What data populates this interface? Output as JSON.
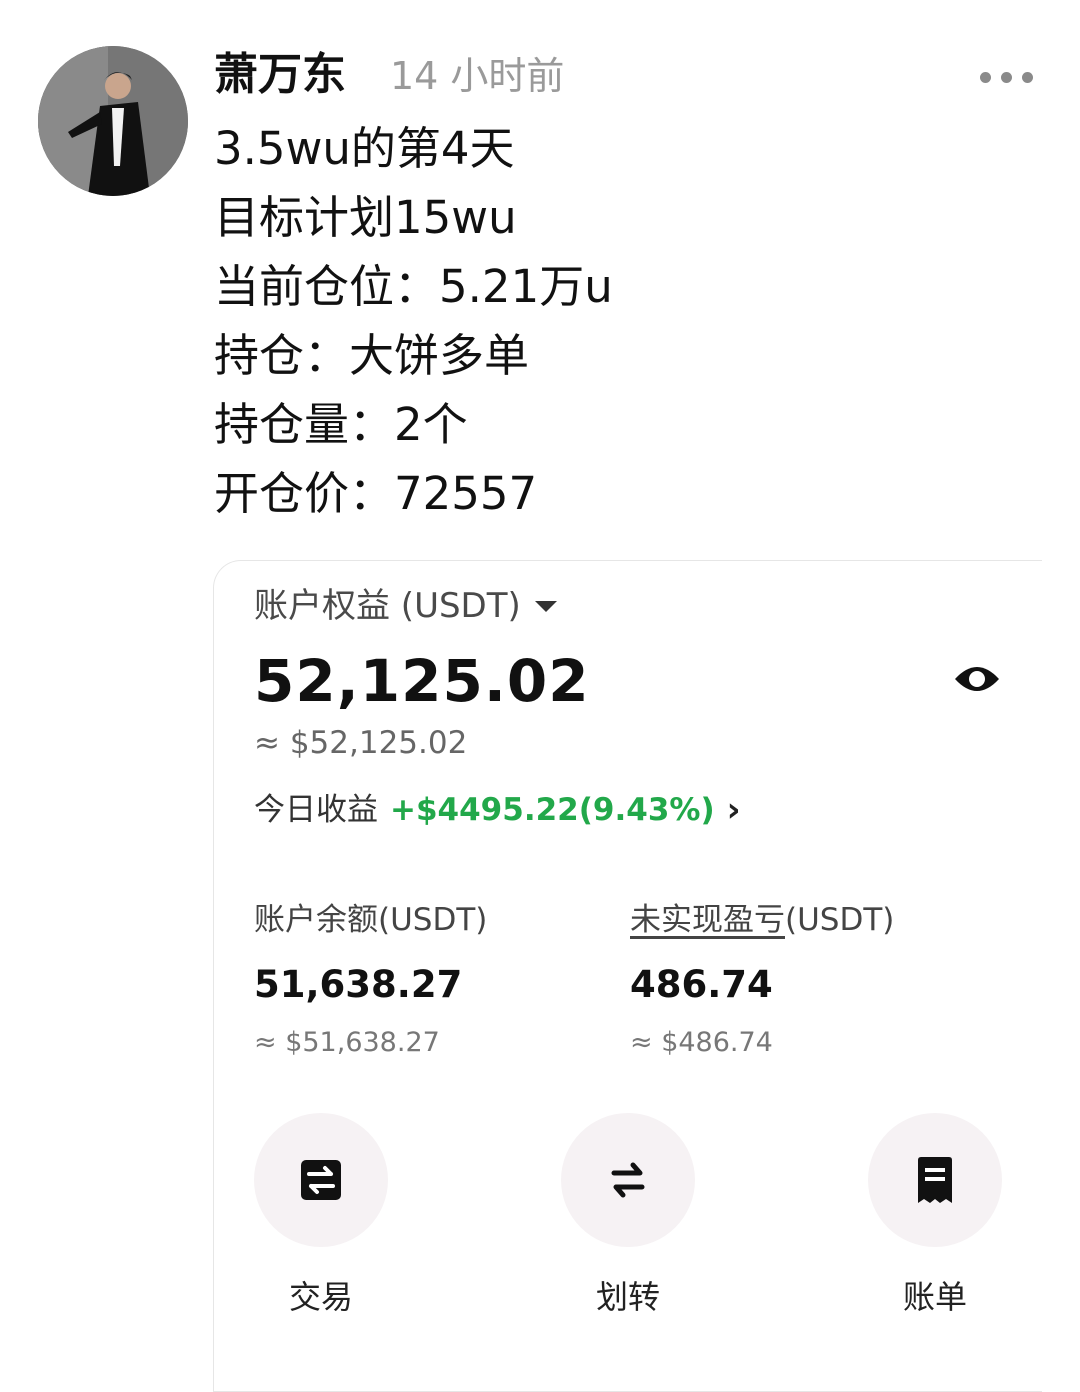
{
  "post": {
    "author": "萧万东",
    "time": "14 小时前",
    "lines": [
      "3.5wu的第4天",
      "目标计划15wu",
      "当前仓位：5.21万u",
      "持仓：大饼多单",
      "持仓量：2个",
      "开仓价：72557"
    ],
    "more_icon": "more-dots-icon"
  },
  "account": {
    "equity_label": "账户权益 (USDT)",
    "equity_value": "52,125.02",
    "equity_approx": "≈ $52,125.02",
    "today_label": "今日收益",
    "today_pnl": "+$4495.22(9.43%)",
    "today_chevron": "›",
    "balance_label": "账户余额(USDT)",
    "balance_value": "51,638.27",
    "balance_approx": "≈ $51,638.27",
    "unrealized_label": "未实现盈亏",
    "unrealized_suffix": "(USDT)",
    "unrealized_value": "486.74",
    "unrealized_approx": "≈ $486.74"
  },
  "actions": [
    {
      "label": "交易",
      "icon": "trade-icon"
    },
    {
      "label": "划转",
      "icon": "transfer-icon"
    },
    {
      "label": "账单",
      "icon": "bill-icon"
    }
  ],
  "colors": {
    "profit": "#22a84a",
    "button_bg": "#f6f2f4"
  }
}
